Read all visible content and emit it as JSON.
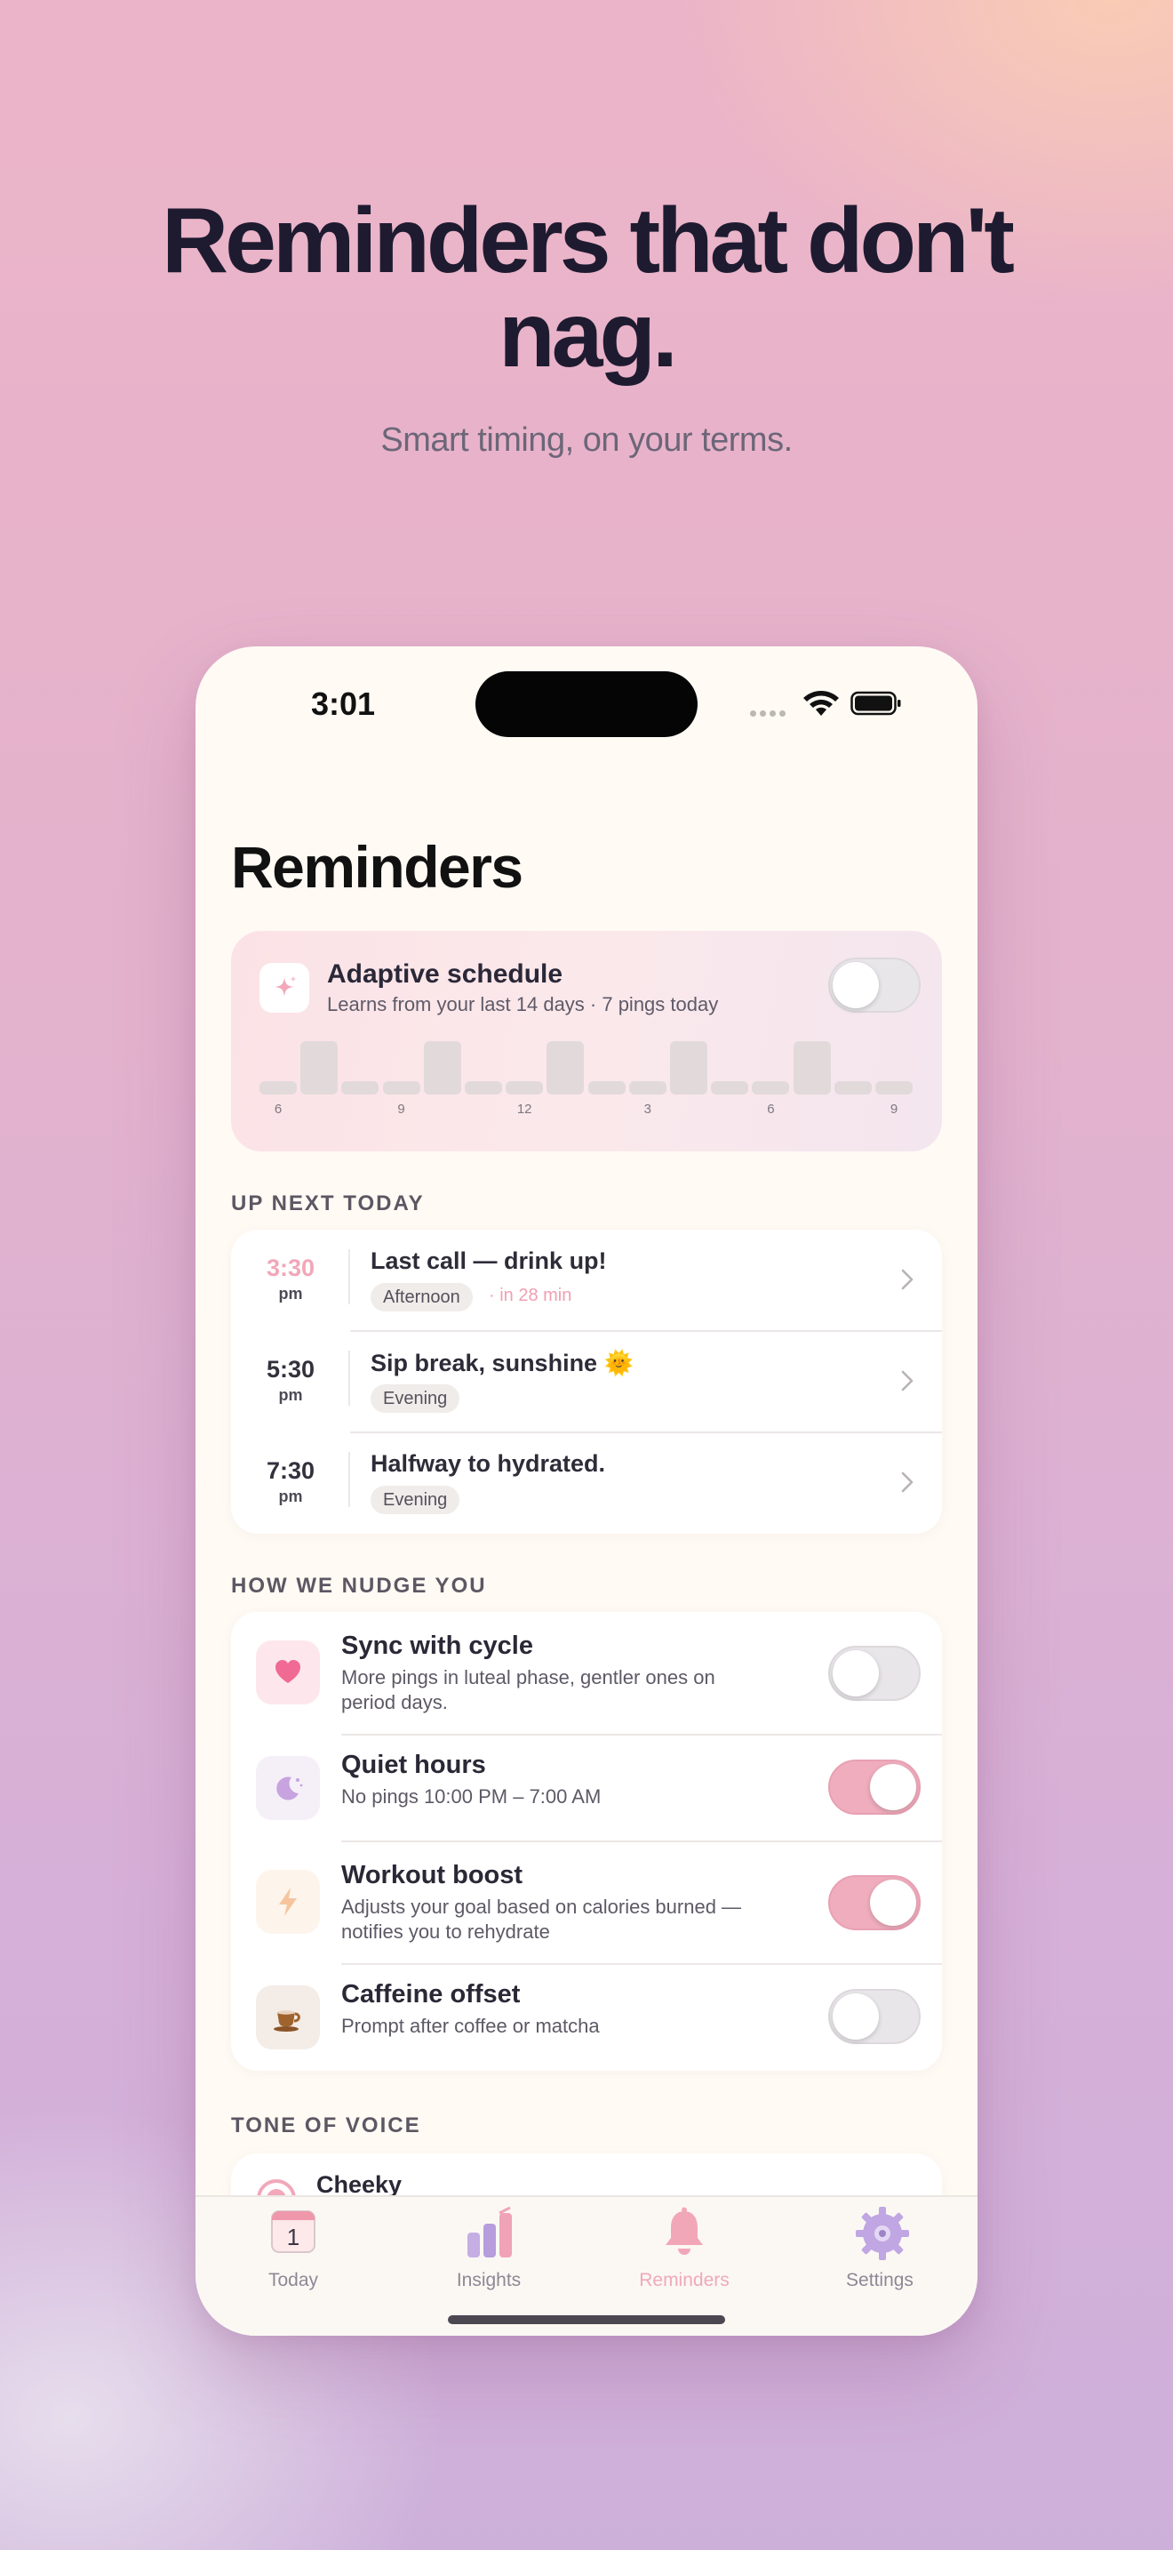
{
  "promo": {
    "headline_line1": "Reminders that don't",
    "headline_line2": "nag.",
    "subheadline": "Smart timing, on your terms."
  },
  "status_bar": {
    "time": "3:01"
  },
  "screen": {
    "title": "Reminders"
  },
  "adaptive_schedule": {
    "title": "Adaptive schedule",
    "subtitle": "Learns from your last 14 days · 7 pings today",
    "enabled": false,
    "hourly_activity": [
      0.25,
      1,
      0.25,
      0.25,
      1,
      0.25,
      0.25,
      1,
      0.25,
      0.25,
      1,
      0.25,
      0.25,
      1,
      0.25,
      0.25
    ],
    "tick_labels": [
      "6",
      "9",
      "12",
      "3",
      "6",
      "9"
    ]
  },
  "up_next": {
    "section_label": "UP NEXT TODAY",
    "items": [
      {
        "time": "3:30",
        "ampm": "pm",
        "title": "Last call — drink up!",
        "tag": "Afternoon",
        "eta": "· in 28 min",
        "highlight": true
      },
      {
        "time": "5:30",
        "ampm": "pm",
        "title": "Sip break, sunshine 🌞",
        "tag": "Evening",
        "eta": "",
        "highlight": false
      },
      {
        "time": "7:30",
        "ampm": "pm",
        "title": "Halfway to hydrated.",
        "tag": "Evening",
        "eta": "",
        "highlight": false
      }
    ]
  },
  "nudges": {
    "section_label": "HOW WE NUDGE YOU",
    "items": [
      {
        "icon": "heart-icon",
        "title": "Sync with cycle",
        "subtitle_line1": "More pings in luteal phase, gentler ones on",
        "subtitle_line2": "period days.",
        "enabled": false
      },
      {
        "icon": "moon-icon",
        "title": "Quiet hours",
        "subtitle_line1": "No pings 10:00 PM – 7:00 AM",
        "subtitle_line2": "",
        "enabled": true
      },
      {
        "icon": "lightning-icon",
        "title": "Workout boost",
        "subtitle_line1": "Adjusts your goal based on calories burned —",
        "subtitle_line2": "notifies you to rehydrate",
        "enabled": true
      },
      {
        "icon": "coffee-cup-icon",
        "title": "Caffeine offset",
        "subtitle_line1": "Prompt after coffee or matcha",
        "subtitle_line2": "",
        "enabled": false
      }
    ]
  },
  "tone": {
    "section_label": "TONE OF VOICE",
    "first_option": "Cheeky"
  },
  "tab_bar": {
    "tabs": [
      {
        "label": "Today",
        "icon": "calendar-icon",
        "calendar_day": "1",
        "active": false
      },
      {
        "label": "Insights",
        "icon": "bar-chart-icon",
        "active": false
      },
      {
        "label": "Reminders",
        "icon": "bell-icon",
        "active": true
      },
      {
        "label": "Settings",
        "icon": "gear-icon",
        "active": false
      }
    ]
  },
  "colors": {
    "accent_pink": "#efadbd",
    "text_dark": "#1e1b30",
    "card_white": "#ffffff",
    "app_background": "#fffaf4"
  }
}
